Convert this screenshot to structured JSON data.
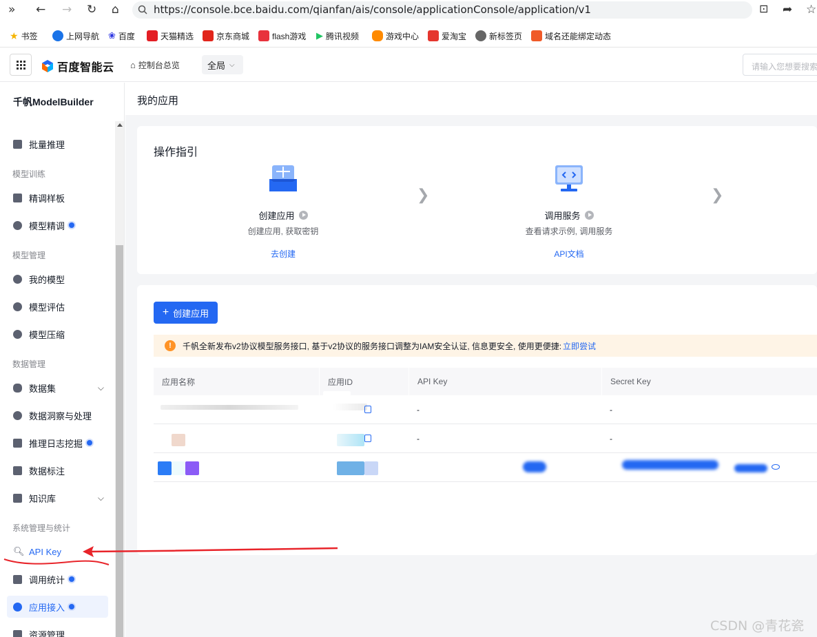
{
  "browser": {
    "url": "https://console.bce.baidu.com/qianfan/ais/console/applicationConsole/application/v1",
    "bookmarks": [
      "书签",
      "上网导航",
      "百度",
      "天猫精选",
      "京东商城",
      "flash游戏",
      "腾讯视频",
      "游戏中心",
      "爱淘宝",
      "新标签页",
      "域名还能绑定动态"
    ]
  },
  "header": {
    "brand": "百度智能云",
    "console_home": "控制台总览",
    "region": "全局",
    "search_placeholder": "请输入您想要搜索"
  },
  "sidebar": {
    "title": "千帆ModelBuilder",
    "items": [
      {
        "label": "批量推理"
      },
      {
        "group": "模型训练"
      },
      {
        "label": "精调样板"
      },
      {
        "label": "模型精调",
        "dot": true
      },
      {
        "group": "模型管理"
      },
      {
        "label": "我的模型"
      },
      {
        "label": "模型评估"
      },
      {
        "label": "模型压缩"
      },
      {
        "group": "数据管理"
      },
      {
        "label": "数据集",
        "expand": true
      },
      {
        "label": "数据洞察与处理"
      },
      {
        "label": "推理日志挖掘",
        "dot": true
      },
      {
        "label": "数据标注"
      },
      {
        "label": "知识库",
        "expand": true
      },
      {
        "group": "系统管理与统计"
      },
      {
        "label": "API Key"
      },
      {
        "label": "调用统计",
        "dot": true
      },
      {
        "label": "应用接入",
        "dot": true,
        "active": true
      },
      {
        "label": "资源管理"
      }
    ]
  },
  "main": {
    "page_title": "我的应用",
    "guide": {
      "title": "操作指引",
      "steps": [
        {
          "title": "创建应用",
          "desc": "创建应用, 获取密钥",
          "link": "去创建"
        },
        {
          "title": "调用服务",
          "desc": "查看请求示例, 调用服务",
          "link": "API文档"
        }
      ]
    },
    "create_button": "创建应用",
    "notice": {
      "text": "千帆全新发布v2协议模型服务接口, 基于v2协议的服务接口调整为IAM安全认证, 信息更安全, 使用更便捷:",
      "link": "立即尝试"
    },
    "table": {
      "columns": [
        "应用名称",
        "应用ID",
        "API Key",
        "Secret Key"
      ],
      "rows": [
        {
          "api_key": "-",
          "secret_key": "-"
        },
        {
          "api_key": "-",
          "secret_key": "-"
        },
        {
          "api_key": "",
          "secret_key": ""
        }
      ]
    }
  },
  "watermark": "CSDN @青花瓷",
  "colors": {
    "accent": "#2468f2",
    "warning": "#ff9326",
    "annotation": "#e8242a"
  }
}
